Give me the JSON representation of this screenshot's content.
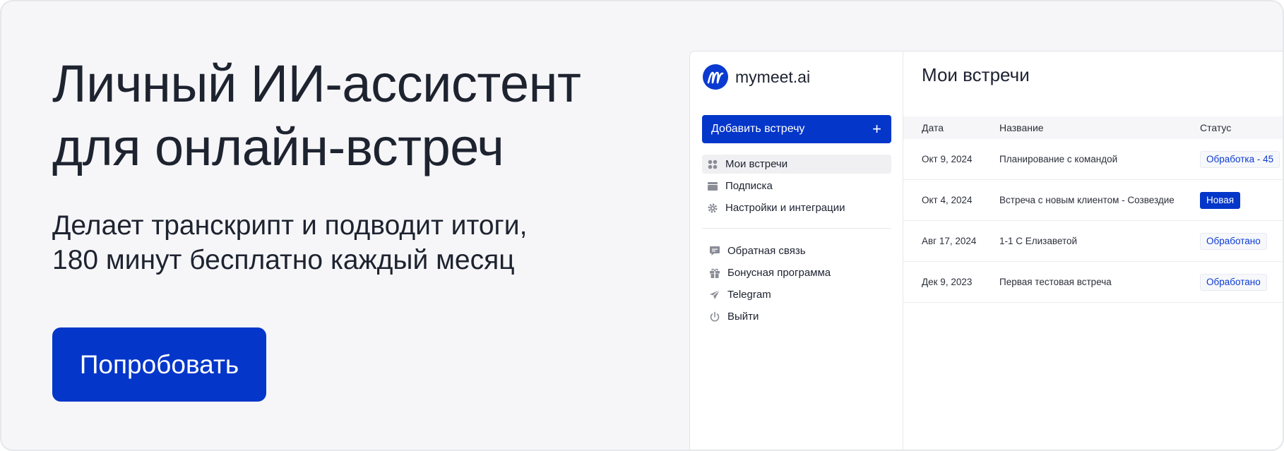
{
  "promo": {
    "headline": [
      "Личный ИИ-ассистент",
      "для онлайн-встреч"
    ],
    "subline": [
      "Делает транскрипт и подводит итоги,",
      "180 минут бесплатно каждый месяц"
    ],
    "cta_label": "Попробовать"
  },
  "app": {
    "logo_text": "mymeet.ai",
    "add_button_label": "Добавить встречу",
    "add_button_icon": "+",
    "nav_primary": [
      {
        "label": "Мои встречи",
        "icon": "grid-icon",
        "active": true
      },
      {
        "label": "Подписка",
        "icon": "wallet-icon",
        "active": false
      },
      {
        "label": "Настройки и интеграции",
        "icon": "gear-icon",
        "active": false
      }
    ],
    "nav_secondary": [
      {
        "label": "Обратная связь",
        "icon": "chat-icon"
      },
      {
        "label": "Бонусная программа",
        "icon": "gift-icon"
      },
      {
        "label": "Telegram",
        "icon": "send-icon"
      },
      {
        "label": "Выйти",
        "icon": "power-icon"
      }
    ],
    "main_title": "Мои встречи",
    "table": {
      "columns": [
        "Дата",
        "Название",
        "Статус"
      ],
      "rows": [
        {
          "date": "Окт 9, 2024",
          "name": "Планирование с командой",
          "status": "Обработка - 45",
          "style": "outline"
        },
        {
          "date": "Окт 4, 2024",
          "name": "Встреча с новым клиентом - Созвездие",
          "status": "Новая",
          "style": "filled"
        },
        {
          "date": "Авг 17, 2024",
          "name": "1-1 С Елизаветой",
          "status": "Обработано",
          "style": "outline"
        },
        {
          "date": "Дек 9, 2023",
          "name": "Первая тестовая встреча",
          "status": "Обработано",
          "style": "outline"
        }
      ]
    }
  },
  "colors": {
    "accent": "#0436c9",
    "text": "#1e2330",
    "background": "#f6f6f8"
  }
}
